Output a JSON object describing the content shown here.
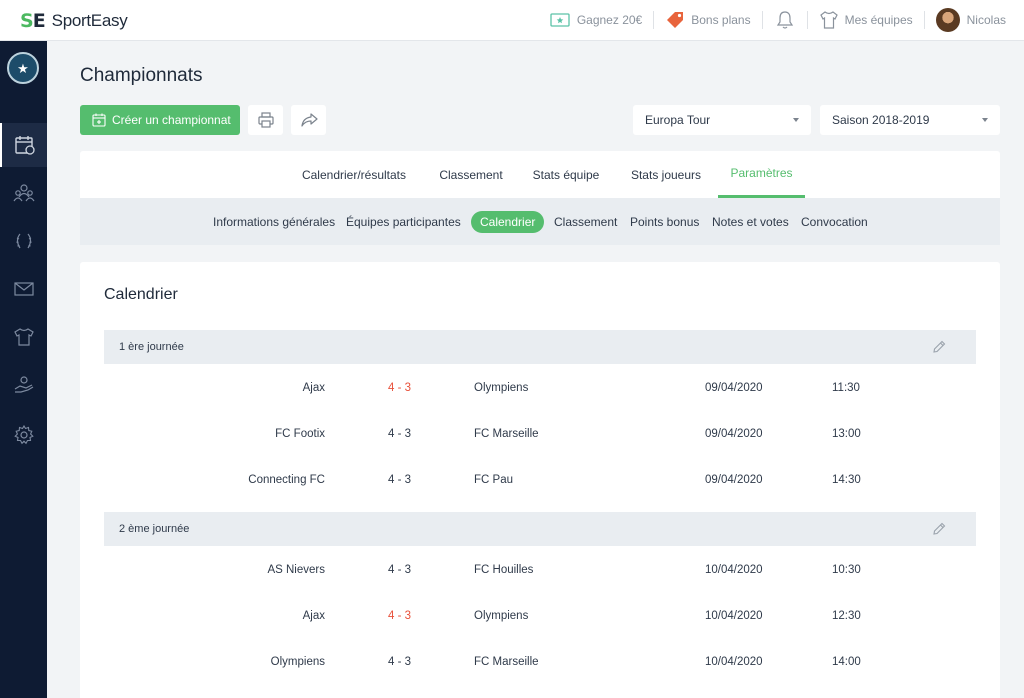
{
  "app": {
    "logo_mark": "SE",
    "logo_text": "SportEasy"
  },
  "topnav": {
    "earn": "Gagnez 20€",
    "deals": "Bons plans",
    "teams": "Mes équipes",
    "user": "Nicolas"
  },
  "sidebar": {
    "items": [
      "team-badge",
      "calendar",
      "members",
      "trophies",
      "messages",
      "jerseys",
      "handshake",
      "settings"
    ],
    "active": "calendar"
  },
  "page": {
    "title": "Championnats"
  },
  "toolbar": {
    "create_label": "Créer un championnat",
    "competition_select": "Europa Tour",
    "season_select": "Saison 2018-2019"
  },
  "tabs": [
    {
      "label": "Calendrier/résultats",
      "active": false
    },
    {
      "label": "Classement",
      "active": false
    },
    {
      "label": "Stats équipe",
      "active": false
    },
    {
      "label": "Stats joueurs",
      "active": false
    },
    {
      "label": "Paramètres",
      "active": true
    }
  ],
  "subtabs": [
    {
      "label": "Informations générales",
      "active": false
    },
    {
      "label": "Équipes participantes",
      "active": false
    },
    {
      "label": "Calendrier",
      "active": true
    },
    {
      "label": "Classement",
      "active": false
    },
    {
      "label": "Points bonus",
      "active": false
    },
    {
      "label": "Notes et votes",
      "active": false
    },
    {
      "label": "Convocation",
      "active": false
    }
  ],
  "calendar": {
    "title": "Calendrier",
    "days": [
      {
        "label": "1 ère journée",
        "matches": [
          {
            "home": "Ajax",
            "score": "4 - 3",
            "highlight": true,
            "away": "Olympiens",
            "date": "09/04/2020",
            "time": "11:30"
          },
          {
            "home": "FC Footix",
            "score": "4 - 3",
            "highlight": false,
            "away": "FC Marseille",
            "date": "09/04/2020",
            "time": "13:00"
          },
          {
            "home": "Connecting FC",
            "score": "4 - 3",
            "highlight": false,
            "away": "FC Pau",
            "date": "09/04/2020",
            "time": "14:30"
          }
        ]
      },
      {
        "label": "2 ème journée",
        "matches": [
          {
            "home": "AS Nievers",
            "score": "4 - 3",
            "highlight": false,
            "away": "FC Houilles",
            "date": "10/04/2020",
            "time": "10:30"
          },
          {
            "home": "Ajax",
            "score": "4 - 3",
            "highlight": true,
            "away": "Olympiens",
            "date": "10/04/2020",
            "time": "12:30"
          },
          {
            "home": "Olympiens",
            "score": "4 - 3",
            "highlight": false,
            "away": "FC Marseille",
            "date": "10/04/2020",
            "time": "14:00"
          }
        ]
      }
    ]
  },
  "colors": {
    "accent": "#55bd6e",
    "sidebar": "#0e1b33",
    "score_highlight": "#e8503a",
    "deal_tag": "#e8643c"
  }
}
